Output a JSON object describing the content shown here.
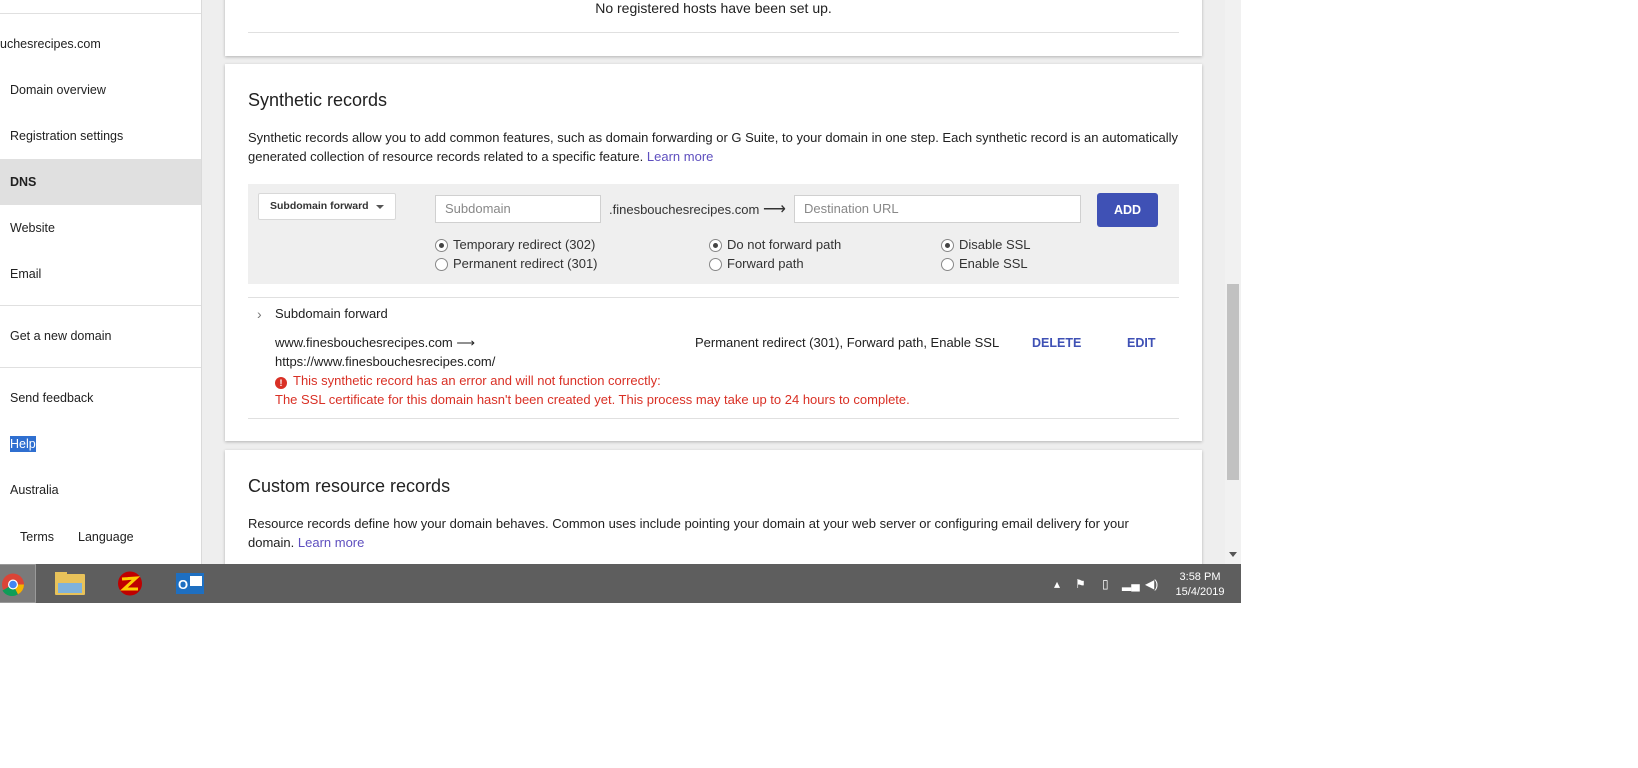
{
  "sidebar": {
    "domain": "uchesrecipes.com",
    "items": [
      "Domain overview",
      "Registration settings",
      "DNS",
      "Website",
      "Email"
    ],
    "get_domain": "Get a new domain",
    "feedback": "Send feedback",
    "help": "Help",
    "country": "Australia",
    "terms": "Terms",
    "language": "Language"
  },
  "hosts": {
    "empty": "No registered hosts have been set up."
  },
  "synthetic": {
    "title": "Synthetic records",
    "desc": "Synthetic records allow you to add common features, such as domain forwarding or G Suite, to your domain in one step. Each synthetic record is an automatically generated collection of resource records related to a specific feature.",
    "learn_more": "Learn more",
    "form": {
      "type": "Subdomain forward",
      "subdomain_placeholder": "Subdomain",
      "suffix": ".finesbouchesrecipes.com",
      "arrow": "⟶",
      "dest_placeholder": "Destination URL",
      "add": "ADD",
      "redirect": {
        "temporary": "Temporary redirect (302)",
        "permanent": "Permanent redirect (301)"
      },
      "path": {
        "no_forward": "Do not forward path",
        "forward": "Forward path"
      },
      "ssl": {
        "disable": "Disable SSL",
        "enable": "Enable SSL"
      }
    },
    "record": {
      "type": "Subdomain forward",
      "from": "www.finesbouchesrecipes.com ⟶",
      "to": "https://www.finesbouchesrecipes.com/",
      "settings": "Permanent redirect (301), Forward path, Enable SSL",
      "delete": "DELETE",
      "edit": "EDIT",
      "error1": "This synthetic record has an error and will not function correctly:",
      "error2": "The SSL certificate for this domain hasn't been created yet. This process may take up to 24 hours to complete."
    }
  },
  "custom": {
    "title": "Custom resource records",
    "desc": "Resource records define how your domain behaves. Common uses include pointing your domain at your web server or configuring email delivery for your domain.",
    "learn_more": "Learn more"
  },
  "taskbar": {
    "time": "3:58 PM",
    "date": "15/4/2019",
    "apps": [
      "chrome-icon",
      "file-explorer-icon",
      "filezilla-icon",
      "outlook-icon"
    ]
  },
  "colors": {
    "accent": "#3f51b5",
    "error": "#d93025",
    "link": "#5e4fbf"
  }
}
